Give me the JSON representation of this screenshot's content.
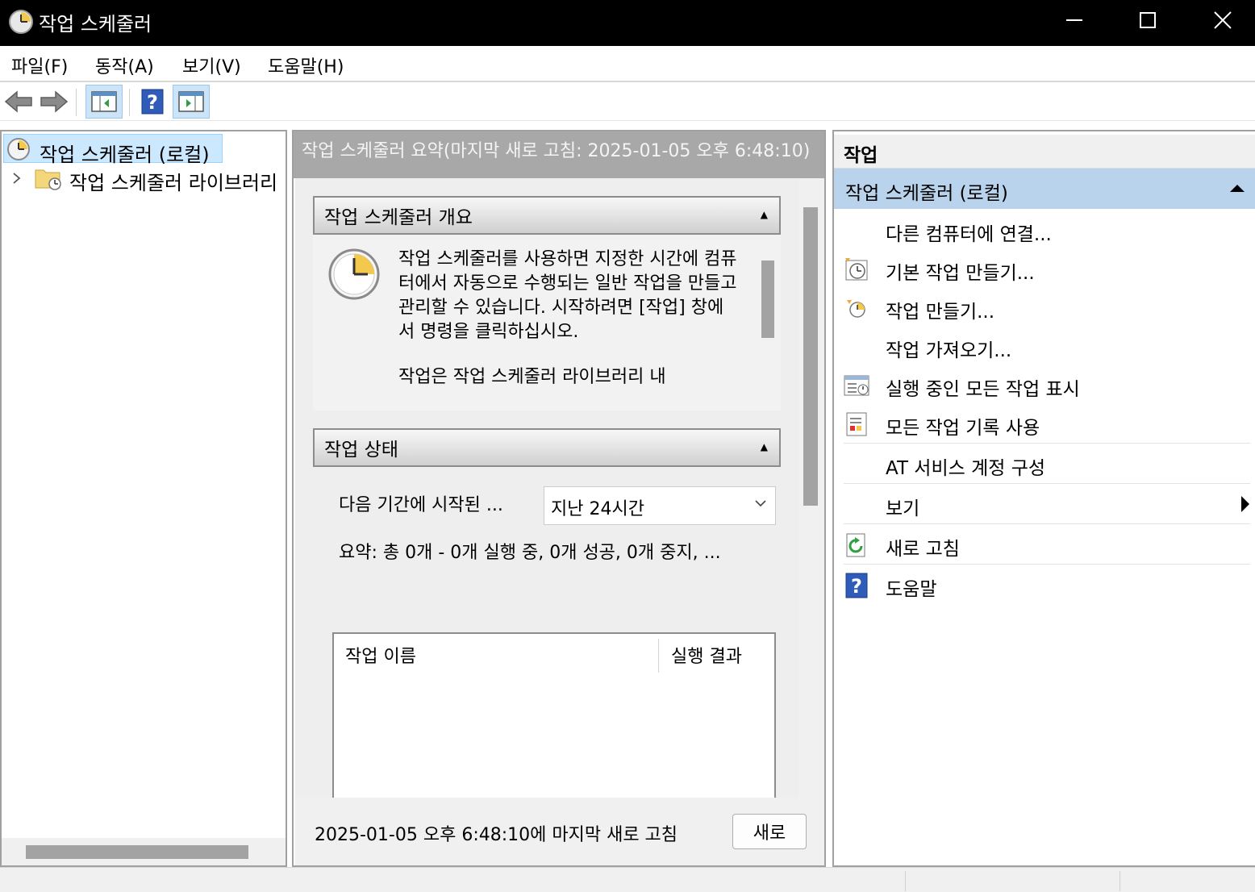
{
  "window": {
    "title": "작업 스케줄러"
  },
  "menu": [
    {
      "label": "파일(F)"
    },
    {
      "label": "동작(A)"
    },
    {
      "label": "보기(V)"
    },
    {
      "label": "도움말(H)"
    }
  ],
  "toolbar": {
    "buttons": [
      "back-icon",
      "forward-icon",
      "show-hide-console-tree-icon",
      "help-icon",
      "show-hide-action-pane-icon"
    ]
  },
  "tree": {
    "root": {
      "label": "작업 스케줄러 (로컬)",
      "selected": true
    },
    "children": [
      {
        "label": "작업 스케줄러 라이브러리",
        "expanded": false
      }
    ]
  },
  "main": {
    "header": "작업 스케줄러 요약(마지막 새로 고침: 2025-01-05 오후 6:48:10)",
    "overview": {
      "title": "작업 스케줄러 개요",
      "text": "작업 스케줄러를 사용하면 지정한 시간에 컴퓨터에서 자동으로 수행되는 일반 작업을 만들고 관리할 수 있습니다. 시작하려면 [작업] 창에서 명령을 클릭하십시오.",
      "text2": "작업은 작업 스케줄러 라이브러리 내"
    },
    "status": {
      "title": "작업 상태",
      "period_label": "다음 기간에 시작된 ...",
      "period_value": "지난 24시간",
      "summary": "요약: 총 0개 - 0개 실행 중, 0개 성공, 0개 중지, ...",
      "columns": [
        "작업 이름",
        "실행 결과"
      ]
    },
    "footer": {
      "text": "2025-01-05 오후 6:48:10에 마지막 새로 고침",
      "refresh_label": "새로"
    }
  },
  "actions": {
    "title": "작업",
    "group": "작업 스케줄러 (로컬)",
    "items": [
      {
        "label": "다른 컴퓨터에 연결...",
        "icon": ""
      },
      {
        "label": "기본 작업 만들기...",
        "icon": "create-basic-task-icon"
      },
      {
        "label": "작업 만들기...",
        "icon": "create-task-icon"
      },
      {
        "label": "작업 가져오기...",
        "icon": ""
      },
      {
        "label": "실행 중인 모든 작업 표시",
        "icon": "running-tasks-icon"
      },
      {
        "label": "모든 작업 기록 사용",
        "icon": "task-history-icon"
      },
      {
        "label": "AT 서비스 계정 구성",
        "icon": ""
      },
      {
        "label": "보기",
        "icon": "",
        "submenu": true
      },
      {
        "label": "새로 고침",
        "icon": "refresh-icon"
      },
      {
        "label": "도움말",
        "icon": "help-icon"
      }
    ]
  },
  "colors": {
    "accent_selected": "#cce8ff",
    "group_header": "#b9d3ec",
    "titlebar": "#000000"
  }
}
